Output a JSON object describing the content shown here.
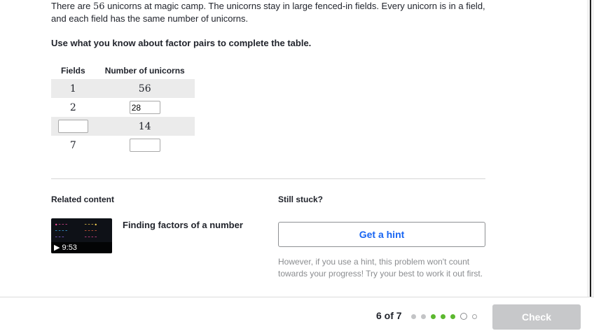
{
  "problem": {
    "text_before": "There are ",
    "number": "56",
    "text_after": " unicorns at magic camp. The unicorns stay in large fenced-in fields. Every unicorn is in a field, and each field has the same number of unicorns.",
    "instruction": "Use what you know about factor pairs to complete the table."
  },
  "table": {
    "headers": [
      "Fields",
      "Number of unicorns"
    ],
    "rows": [
      {
        "fields": "1",
        "unicorns": "56"
      },
      {
        "fields": "2",
        "unicorns_input": "28"
      },
      {
        "fields_input": "",
        "unicorns": "14"
      },
      {
        "fields": "7",
        "unicorns_input": ""
      }
    ]
  },
  "related": {
    "label": "Related content",
    "video_title": "Finding factors of a number",
    "video_duration": "▶ 9:53"
  },
  "stuck": {
    "label": "Still stuck?",
    "hint_button": "Get a hint",
    "note": "However, if you use a hint, this problem won't count towards your progress! Try your best to work it out first."
  },
  "footer": {
    "progress": "6 of 7",
    "check_button": "Check",
    "dots": [
      "grey",
      "grey",
      "correct",
      "correct",
      "correct",
      "current",
      "empty"
    ],
    "colors": {
      "correct": "#5cb82f",
      "grey": "#c3c4c6",
      "hint": "#1865f2"
    }
  }
}
